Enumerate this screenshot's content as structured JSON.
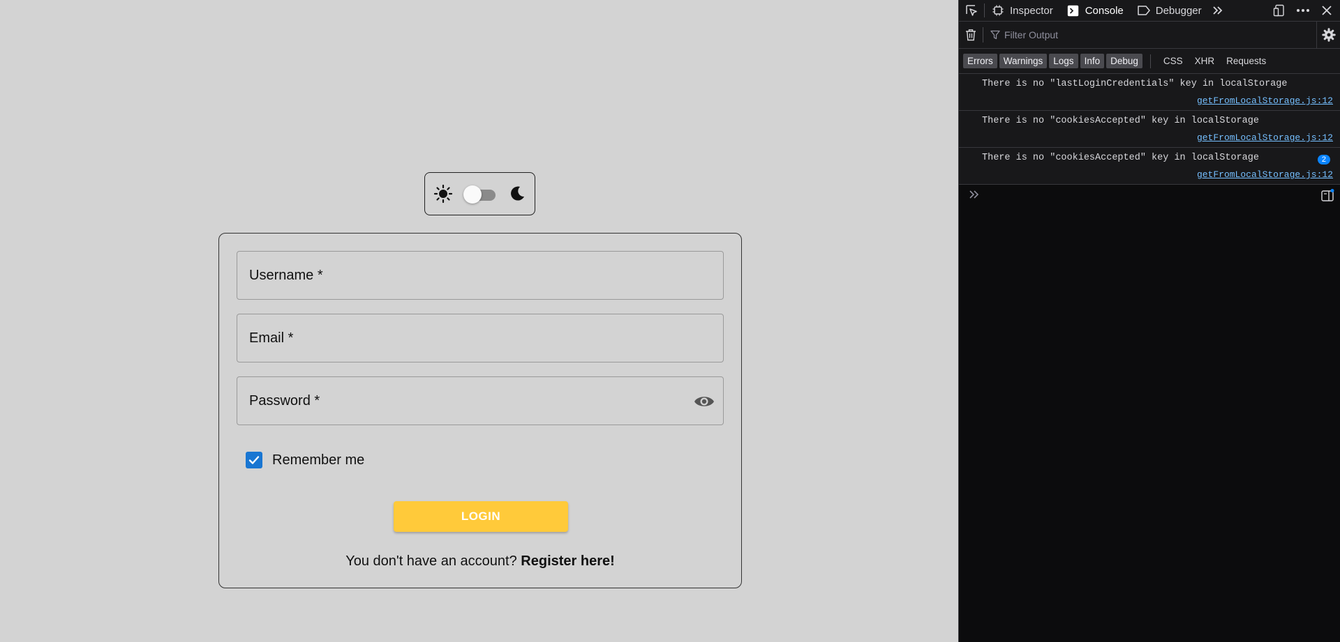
{
  "login": {
    "username_label": "Username *",
    "email_label": "Email *",
    "password_label": "Password *",
    "remember_label": "Remember me",
    "remember_checked": true,
    "login_button": "LOGIN",
    "no_account_text": "You don't have an account? ",
    "register_link": "Register here!"
  },
  "theme_toggle": {
    "light_icon": "sun-icon",
    "dark_icon": "moon-icon",
    "dark_mode_on": false
  },
  "devtools": {
    "tabs": [
      {
        "label": "Inspector",
        "icon": "inspector-icon"
      },
      {
        "label": "Console",
        "icon": "console-icon",
        "active": true
      },
      {
        "label": "Debugger",
        "icon": "debugger-icon"
      }
    ],
    "filter_placeholder": "Filter Output",
    "filter_chips": [
      "Errors",
      "Warnings",
      "Logs",
      "Info",
      "Debug"
    ],
    "filter_plain": [
      "CSS",
      "XHR",
      "Requests"
    ],
    "messages": [
      {
        "text": "There is no \"lastLoginCredentials\" key in localStorage",
        "source": "getFromLocalStorage.js:12"
      },
      {
        "text": "There is no \"cookiesAccepted\" key in localStorage",
        "source": "getFromLocalStorage.js:12"
      },
      {
        "text": "There is no \"cookiesAccepted\" key in localStorage",
        "source": "getFromLocalStorage.js:12",
        "count": "2"
      }
    ]
  },
  "colors": {
    "page_bg": "#d3d3d3",
    "login_button": "#ffca3a",
    "checkbox": "#1976d2",
    "devtools_bg": "#0c0c0d",
    "link": "#75bfff"
  }
}
